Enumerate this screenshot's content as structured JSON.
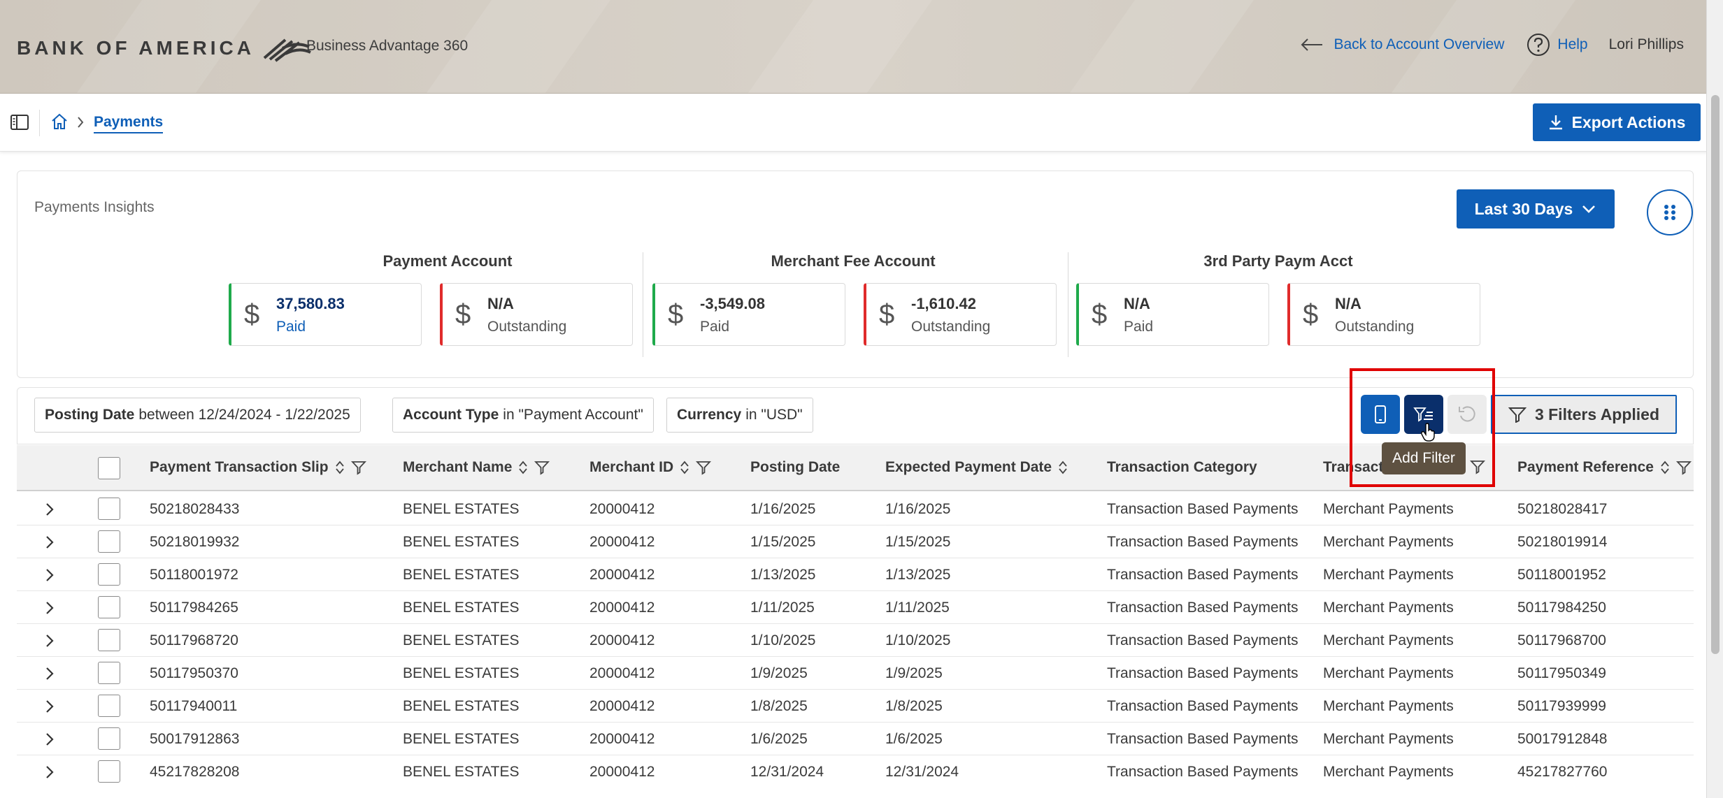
{
  "header": {
    "brand_name": "BANK OF AMERICA",
    "product": "Business Advantage 360",
    "back_link": "Back to Account Overview",
    "help": "Help",
    "user": "Lori Phillips"
  },
  "breadcrumb": {
    "current": "Payments",
    "export_button": "Export Actions"
  },
  "insights": {
    "title": "Payments Insights",
    "range_button": "Last 30 Days",
    "groups": [
      {
        "title": "Payment Account",
        "cards": [
          {
            "amount": "37,580.83",
            "label": "Paid"
          },
          {
            "amount": "N/A",
            "label": "Outstanding"
          }
        ]
      },
      {
        "title": "Merchant Fee Account",
        "cards": [
          {
            "amount": "-3,549.08",
            "label": "Paid"
          },
          {
            "amount": "-1,610.42",
            "label": "Outstanding"
          }
        ]
      },
      {
        "title": "3rd Party Paym Acct",
        "cards": [
          {
            "amount": "N/A",
            "label": "Paid"
          },
          {
            "amount": "N/A",
            "label": "Outstanding"
          }
        ]
      }
    ],
    "currency_symbol": "$"
  },
  "filters": {
    "chips": [
      {
        "field": "Posting Date",
        "condition": "between 12/24/2024 - 1/22/2025"
      },
      {
        "field": "Account Type",
        "condition": "in \"Payment Account\""
      },
      {
        "field": "Currency",
        "condition": "in \"USD\""
      }
    ],
    "applied_label": "3 Filters Applied",
    "tooltip": "Add Filter"
  },
  "table": {
    "columns": [
      "Payment Transaction Slip",
      "Merchant Name",
      "Merchant ID",
      "Posting Date",
      "Expected Payment Date",
      "Transaction Category",
      "Transact",
      "Payment Reference"
    ],
    "rows": [
      [
        "50218028433",
        "BENEL ESTATES",
        "20000412",
        "1/16/2025",
        "1/16/2025",
        "Transaction Based Payments",
        "Merchant Payments",
        "50218028417"
      ],
      [
        "50218019932",
        "BENEL ESTATES",
        "20000412",
        "1/15/2025",
        "1/15/2025",
        "Transaction Based Payments",
        "Merchant Payments",
        "50218019914"
      ],
      [
        "50118001972",
        "BENEL ESTATES",
        "20000412",
        "1/13/2025",
        "1/13/2025",
        "Transaction Based Payments",
        "Merchant Payments",
        "50118001952"
      ],
      [
        "50117984265",
        "BENEL ESTATES",
        "20000412",
        "1/11/2025",
        "1/11/2025",
        "Transaction Based Payments",
        "Merchant Payments",
        "50117984250"
      ],
      [
        "50117968720",
        "BENEL ESTATES",
        "20000412",
        "1/10/2025",
        "1/10/2025",
        "Transaction Based Payments",
        "Merchant Payments",
        "50117968700"
      ],
      [
        "50117950370",
        "BENEL ESTATES",
        "20000412",
        "1/9/2025",
        "1/9/2025",
        "Transaction Based Payments",
        "Merchant Payments",
        "50117950349"
      ],
      [
        "50117940011",
        "BENEL ESTATES",
        "20000412",
        "1/8/2025",
        "1/8/2025",
        "Transaction Based Payments",
        "Merchant Payments",
        "50117939999"
      ],
      [
        "50017912863",
        "BENEL ESTATES",
        "20000412",
        "1/6/2025",
        "1/6/2025",
        "Transaction Based Payments",
        "Merchant Payments",
        "50017912848"
      ],
      [
        "45217828208",
        "BENEL ESTATES",
        "20000412",
        "12/31/2024",
        "12/31/2024",
        "Transaction Based Payments",
        "Merchant Payments",
        "45217827760"
      ]
    ]
  },
  "colors": {
    "brand_blue": "#0f5fb7",
    "navy": "#0a2f6b",
    "paid_green": "#1faa4b",
    "outstanding_red": "#e02b2b",
    "highlight_red": "#e00000"
  }
}
